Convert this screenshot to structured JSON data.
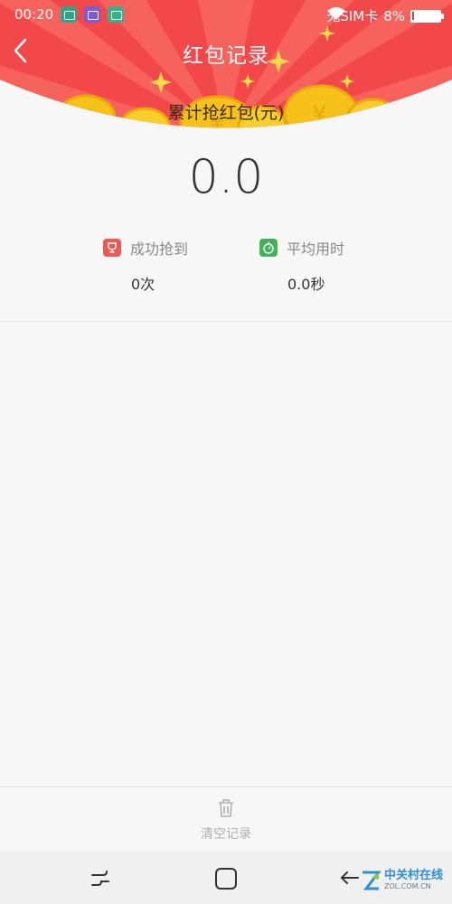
{
  "status_bar": {
    "time": "00:20",
    "carrier": "无SIM卡",
    "battery_percent": "8%",
    "battery_level": 0.08,
    "icons": [
      "map-app-icon",
      "gallery-app-icon",
      "battery-app-icon",
      "wifi-icon"
    ]
  },
  "header": {
    "title": "红包记录",
    "back_icon": "chevron-left-icon",
    "background_color": "#f2484a",
    "coin_color": "#f6c21a"
  },
  "summary": {
    "label": "累计抢红包(元)",
    "amount": "0.0"
  },
  "stats": {
    "success": {
      "icon": "trophy-icon",
      "label": "成功抢到",
      "value": "0次"
    },
    "average": {
      "icon": "timer-icon",
      "label": "平均用时",
      "value": "0.0秒"
    }
  },
  "footer": {
    "clear_icon": "trash-icon",
    "clear_label": "清空记录"
  },
  "nav": {
    "icons": [
      "recent-apps-icon",
      "home-icon",
      "back-icon"
    ]
  },
  "watermark": {
    "main": "中关村在线",
    "sub": "ZOL.COM.CN"
  }
}
